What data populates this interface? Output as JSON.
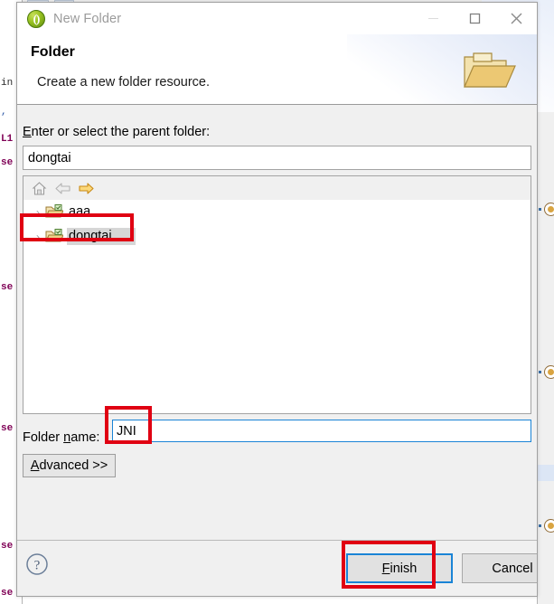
{
  "window": {
    "title": "New Folder",
    "icon": "eclipse-wizard-icon",
    "controls": {
      "minimize": "minimize-icon",
      "maximize": "maximize-icon",
      "close": "close-icon"
    }
  },
  "header": {
    "title": "Folder",
    "description": "Create a new folder resource.",
    "banner_icon": "open-folder-icon"
  },
  "form": {
    "parent_label": "Enter or select the parent folder:",
    "parent_label_mnemonic": "E",
    "parent_value": "dongtai",
    "parent_placeholder": "",
    "folder_name_label": "Folder name:",
    "folder_name_mnemonic": "n",
    "folder_name_value": "JNI",
    "folder_name_placeholder": "",
    "advanced_label": "Advanced >>",
    "advanced_mnemonic": "A"
  },
  "tree": {
    "toolbar": [
      {
        "name": "home-icon",
        "label": "Home",
        "enabled": true
      },
      {
        "name": "back-arrow-icon",
        "label": "Back",
        "enabled": false
      },
      {
        "name": "forward-arrow-icon",
        "label": "Forward",
        "enabled": true
      }
    ],
    "items": [
      {
        "label": "aaa",
        "icon": "project-folder-icon",
        "expander": "›",
        "selected": false
      },
      {
        "label": "dongtai",
        "icon": "project-folder-icon",
        "expander": "›",
        "selected": true
      }
    ]
  },
  "footer": {
    "help_label": "?",
    "finish_label": "Finish",
    "finish_mnemonic": "F",
    "cancel_label": "Cancel",
    "default_button": "Finish"
  },
  "annotations": [
    {
      "name": "annotation-tree-dongtai",
      "color": "#e00012",
      "targets": "dongtai tree item"
    },
    {
      "name": "annotation-folder-name",
      "color": "#e00012",
      "targets": "JNI folder name value"
    },
    {
      "name": "annotation-finish",
      "color": "#e00012",
      "targets": "Finish button"
    }
  ],
  "colors": {
    "accent": "#1a84d6",
    "annotation": "#e00012",
    "dialog_background": "#f0f0f0",
    "field_background": "#ffffff",
    "selection": "#d6d6d6",
    "folder_icon": "#e8bf60"
  },
  "background": {
    "code_fragments": [
      "in",
      "L1",
      "se",
      "se",
      "se",
      "se",
      "se"
    ]
  }
}
